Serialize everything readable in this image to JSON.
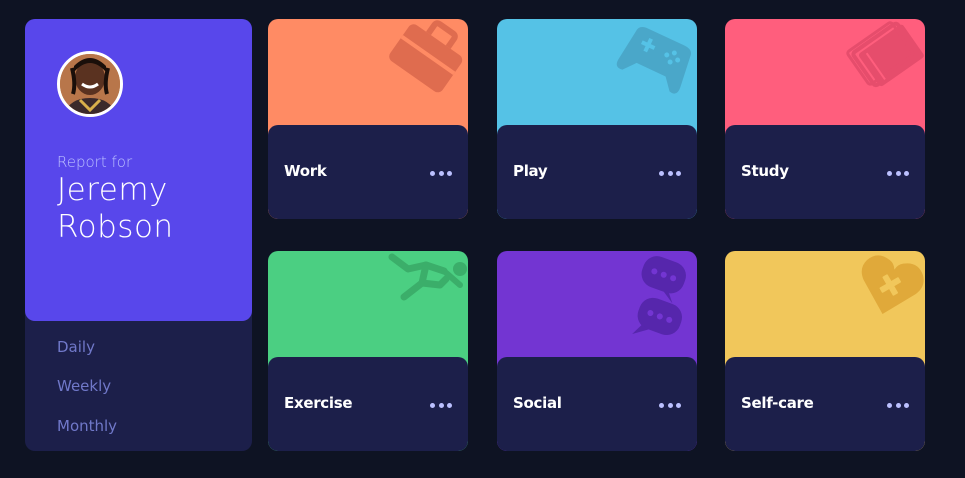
{
  "profile": {
    "report_for": "Report for",
    "name": "Jeremy Robson"
  },
  "periods": [
    "Daily",
    "Weekly",
    "Monthly"
  ],
  "cards": [
    {
      "title": "Work",
      "color": "#ff8b64",
      "icon": "briefcase-icon"
    },
    {
      "title": "Play",
      "color": "#55c2e6",
      "icon": "gamepad-icon"
    },
    {
      "title": "Study",
      "color": "#ff5e7d",
      "icon": "book-icon"
    },
    {
      "title": "Exercise",
      "color": "#4bcf82",
      "icon": "running-icon"
    },
    {
      "title": "Social",
      "color": "#7335d2",
      "icon": "chat-bubbles-icon"
    },
    {
      "title": "Self-care",
      "color": "#f1c75b",
      "icon": "heart-bandage-icon"
    }
  ],
  "theme": {
    "background": "#0e1323",
    "panel": "#1c1f4a",
    "accent": "#5847eb",
    "muted_text": "#7078c9",
    "pale_text": "#bbc0ff"
  }
}
